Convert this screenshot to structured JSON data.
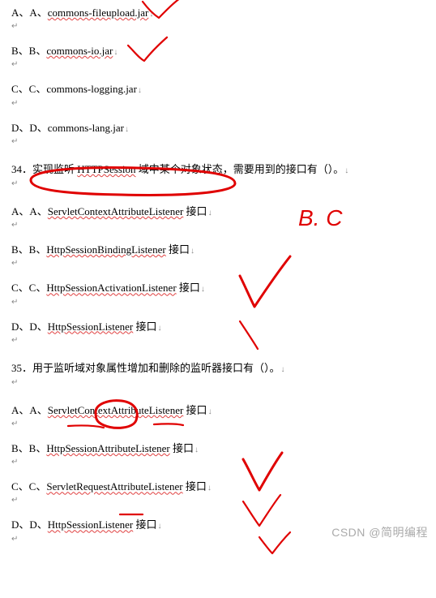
{
  "options_top": [
    {
      "prefix": "A、A、",
      "text": "commons-fileupload.jar"
    },
    {
      "prefix": "B、B、",
      "text": "commons-io.jar"
    },
    {
      "prefix": "C、C、",
      "text": "commons-logging.jar"
    },
    {
      "prefix": "D、D、",
      "text": "commons-lang.jar"
    }
  ],
  "q34": {
    "num": "34．",
    "pre": "实现监听 ",
    "mid": "HTTPSession",
    "post": " 域中某个对象状态，需要用到的接口有（）。"
  },
  "q34_options": [
    {
      "prefix": "A、A、",
      "link": "ServletContextAttributeListener",
      "suffix": " 接口"
    },
    {
      "prefix": "B、B、",
      "link": "HttpSessionBindingListener",
      "suffix": " 接口"
    },
    {
      "prefix": "C、C、",
      "link": "HttpSessionActivationListener",
      "suffix": " 接口"
    },
    {
      "prefix": "D、D、",
      "link": "HttpSessionListener",
      "suffix": " 接口"
    }
  ],
  "q35": {
    "num": "35．",
    "text": "用于监听域对象属性增加和删除的监听器接口有（）。"
  },
  "q35_options": [
    {
      "prefix": "A、A、",
      "link": "ServletContextAttributeListener",
      "suffix": " 接口"
    },
    {
      "prefix": "B、B、",
      "link": "HttpSessionAttributeListener",
      "suffix": " 接口"
    },
    {
      "prefix": "C、C、",
      "link": "ServletRequestAttributeListener",
      "suffix": " 接口"
    },
    {
      "prefix": "D、D、",
      "link": "HttpSessionListener",
      "suffix": " 接口"
    }
  ],
  "arrow": "↓",
  "ret": "↵",
  "handwritten": "B. C",
  "watermark": "CSDN @简明编程"
}
